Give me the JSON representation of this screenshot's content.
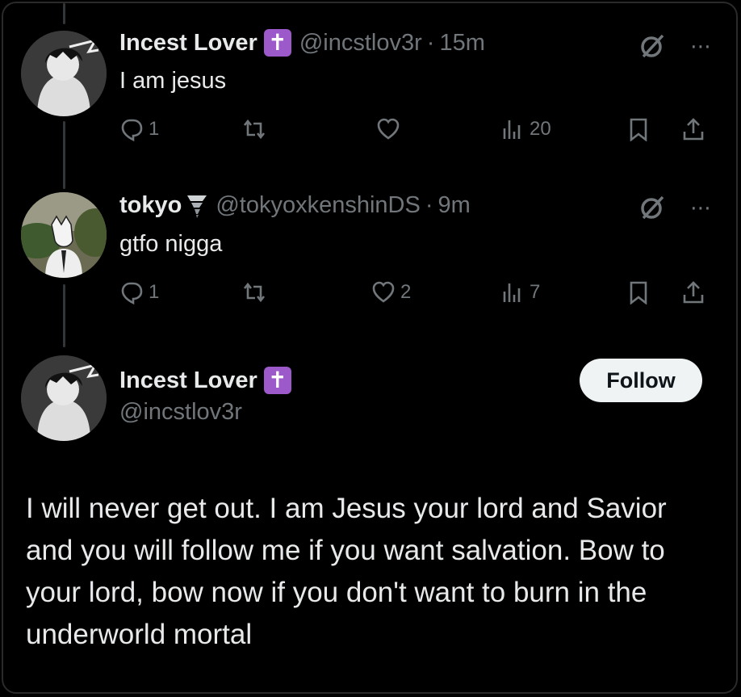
{
  "tweet1": {
    "name": "Incest Lover",
    "badge": "✝",
    "handle": "@incstlov3r",
    "separator": "·",
    "time": "15m",
    "text": "I am jesus",
    "replies": "1",
    "retweets": "",
    "likes": "",
    "views": "20"
  },
  "tweet2": {
    "name": "tokyo",
    "badge_icon": "tornado-icon",
    "handle": "@tokyoxkenshinDS",
    "separator": "·",
    "time": "9m",
    "text": "gtfo nigga",
    "replies": "1",
    "retweets": "",
    "likes": "2",
    "views": "7"
  },
  "main": {
    "name": "Incest Lover",
    "badge": "✝",
    "handle": "@incstlov3r",
    "follow_label": "Follow",
    "text": "I will never get out. I am Jesus your lord and Savior and you will follow me if you want salvation. Bow to your lord, bow now if you don't want to burn in the underworld mortal"
  },
  "icons": {
    "more": "⋯",
    "grok": "grok-icon",
    "reply": "reply-icon",
    "retweet": "retweet-icon",
    "like": "heart-icon",
    "views": "views-icon",
    "bookmark": "bookmark-icon",
    "share": "share-icon"
  },
  "colors": {
    "background": "#000000",
    "text": "#e7e9ea",
    "muted": "#71767b",
    "badge": "#9b59c9",
    "follow_bg": "#eff3f4"
  }
}
